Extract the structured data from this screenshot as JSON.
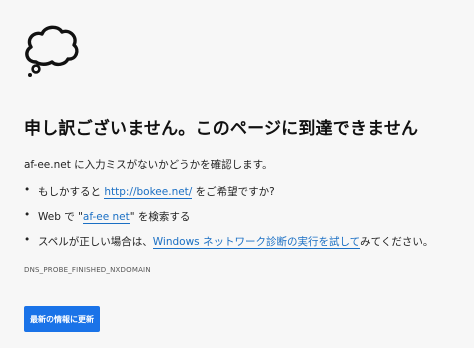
{
  "icon": "thought-cloud-icon",
  "title": "申し訳ございません。このページに到達できません",
  "summary": {
    "domain": "af-ee.net",
    "text": " に入力ミスがないかどうかを確認します。"
  },
  "suggestions": [
    {
      "prefix": "もしかすると ",
      "link": "http://bokee.net/",
      "suffix": " をご希望ですか?"
    },
    {
      "prefix": "Web で \"",
      "link": "af-ee net",
      "suffix": "\" を検索する"
    },
    {
      "prefix": "スペルが正しい場合は、",
      "link": "Windows ネットワーク診断の実行を試して",
      "suffix": "みてください。"
    }
  ],
  "error_code": "DNS_PROBE_FINISHED_NXDOMAIN",
  "reload_label": "最新の情報に更新",
  "colors": {
    "link": "#1a6fc4",
    "button": "#1a73e8",
    "background": "#f7f7f7"
  }
}
